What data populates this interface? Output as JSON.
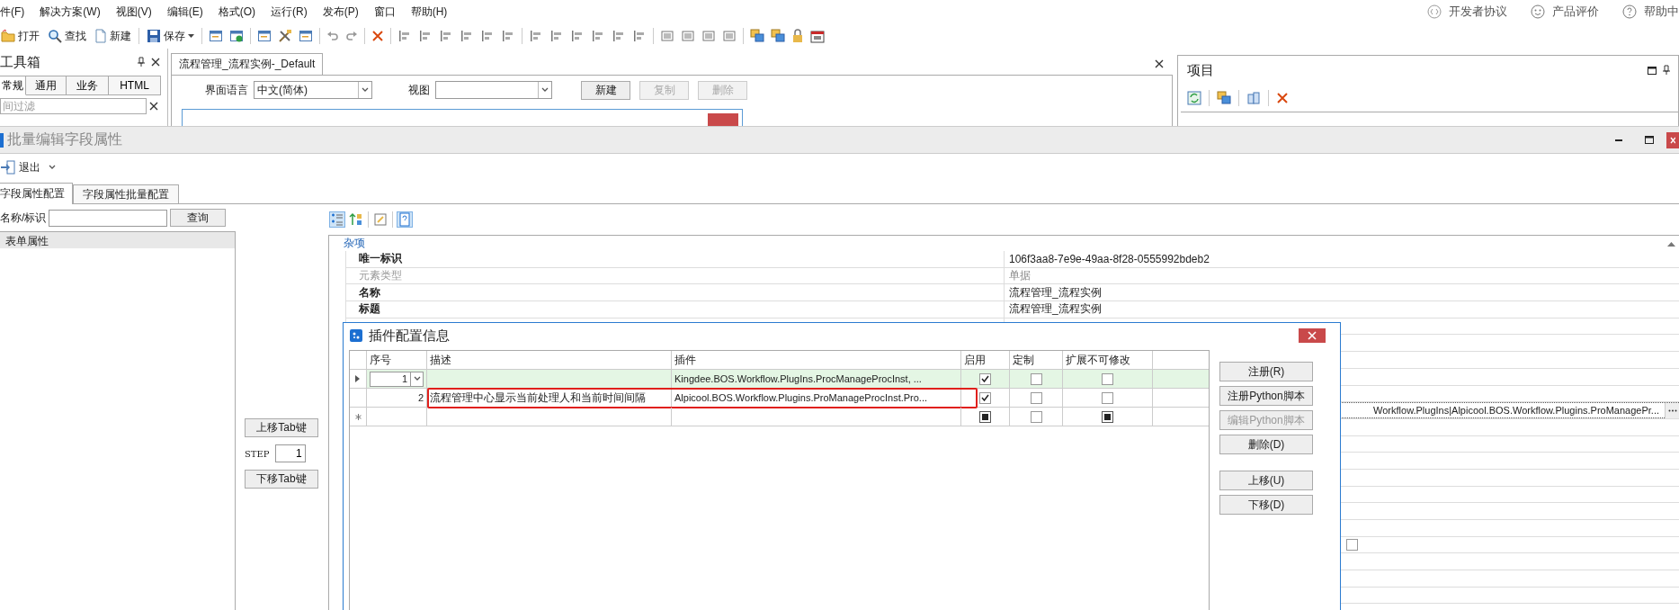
{
  "menu_bar": {
    "items": [
      "件(F)",
      "解决方案(W)",
      "视图(V)",
      "编辑(E)",
      "格式(O)",
      "运行(R)",
      "发布(P)",
      "窗口",
      "帮助(H)"
    ],
    "links": [
      "开发者协议",
      "产品评价",
      "帮助中"
    ]
  },
  "toolbar": {
    "buttons": [
      {
        "label": "打开",
        "dropdown": false
      },
      {
        "label": "查找",
        "dropdown": false
      },
      {
        "label": "新建",
        "dropdown": false
      },
      {
        "label": "保存",
        "dropdown": true
      }
    ]
  },
  "toolbox": {
    "title": "工具箱",
    "tabs": [
      {
        "label": "常规",
        "selected": true
      },
      {
        "label": "通用",
        "selected": false
      },
      {
        "label": "业务",
        "selected": false
      },
      {
        "label": "HTML",
        "selected": false
      }
    ],
    "filter": {
      "placeholder": "间过滤"
    }
  },
  "document": {
    "tab": "流程管理_流程实例-_Default",
    "language_label": "界面语言",
    "language": "中文(简体)",
    "view_label": "视图",
    "buttons": [
      {
        "label": "新建",
        "disabled": false
      },
      {
        "label": "复制",
        "disabled": true
      },
      {
        "label": "删除",
        "disabled": true
      }
    ]
  },
  "project_panel": {
    "title": "项目"
  },
  "batch_window": {
    "title": "批量编辑字段属性",
    "exit": "退出",
    "tabs": [
      {
        "label": "字段属性配置",
        "selected": true
      },
      {
        "label": "字段属性批量配置",
        "selected": false
      }
    ],
    "search_label": "名称/标识",
    "search_button": "查询",
    "list_header": "表单属性",
    "move_up": "上移Tab键",
    "step_label": "STEP",
    "step": "1",
    "move_down": "下移Tab键"
  },
  "property_grid": {
    "category": "杂项",
    "rows": [
      {
        "kind": "text",
        "name": "唯一标识",
        "value": "106f3aa8-7e9e-49aa-8f28-0555992bdeb2",
        "readonly": false
      },
      {
        "kind": "text",
        "name": "元素类型",
        "value": "单据",
        "readonly": true
      },
      {
        "kind": "text",
        "name": "名称",
        "value": "流程管理_流程实例",
        "readonly": false
      },
      {
        "kind": "text",
        "name": "标题",
        "value": "流程管理_流程实例",
        "readonly": false
      },
      {
        "kind": "blank"
      },
      {
        "kind": "blank"
      },
      {
        "kind": "blank"
      },
      {
        "kind": "blank"
      },
      {
        "kind": "blank"
      },
      {
        "kind": "ellipsis",
        "value": "Workflow.PlugIns|Alpicool.BOS.Workflow.Plugins.ProManagePr..."
      },
      {
        "kind": "blank"
      },
      {
        "kind": "blank"
      },
      {
        "kind": "blank"
      },
      {
        "kind": "blank"
      },
      {
        "kind": "blank"
      },
      {
        "kind": "blank"
      },
      {
        "kind": "blank"
      },
      {
        "kind": "checkbox",
        "checked": false
      },
      {
        "kind": "blank"
      },
      {
        "kind": "blank"
      },
      {
        "kind": "blank"
      },
      {
        "kind": "blank"
      }
    ]
  },
  "plugin_dialog": {
    "title": "插件配置信息",
    "columns": [
      "序号",
      "描述",
      "插件",
      "启用",
      "定制",
      "扩展不可修改"
    ],
    "rows": [
      {
        "selected": true,
        "new": false,
        "editing": true,
        "highlighted": false,
        "number": "1",
        "plugin": "Kingdee.BOS.Workflow.PlugIns.ProcManageProcInst, ...",
        "enabled": true,
        "custom": false,
        "locked": false
      },
      {
        "selected": false,
        "new": false,
        "editing": false,
        "highlighted": true,
        "number": "2",
        "description": "流程管理中心显示当前处理人和当前时间间隔",
        "plugin": "Alpicool.BOS.Workflow.Plugins.ProManageProcInst.Pro...",
        "enabled": true,
        "custom": false,
        "locked": false
      },
      {
        "selected": false,
        "new": true,
        "editing": false,
        "highlighted": false,
        "enabled": true,
        "custom": false,
        "locked": true
      }
    ],
    "buttons": [
      {
        "label": "注册(R)",
        "disabled": false
      },
      {
        "label": "注册Python脚本",
        "disabled": false
      },
      {
        "label": "编辑Python脚本",
        "disabled": true
      },
      {
        "label": "删除(D)",
        "disabled": false
      },
      {
        "label": "上移(U)",
        "disabled": false
      },
      {
        "label": "下移(D)",
        "disabled": false
      }
    ]
  }
}
